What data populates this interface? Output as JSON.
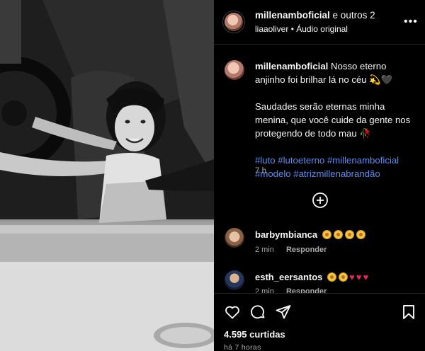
{
  "post": {
    "author": "millenamboficial",
    "coauthors_text": "e outros 2",
    "subtitle_user": "liaaoliver",
    "subtitle_sep": "•",
    "audio": "Áudio original",
    "more_icon": "more-horizontal-icon"
  },
  "caption": {
    "user": "millenamboficial",
    "line1": "Nosso eterno anjinho foi brilhar lá no céu 💫🖤",
    "line2": "Saudades serão eternas minha menina, que você cuide da gente nos protegendo de todo mau 🥀",
    "hashtags": [
      "#luto",
      "#lutoeterno",
      "#millenamboficial",
      "#modelo",
      "#atrizmillenabrandão"
    ],
    "time": "7 h"
  },
  "comments": [
    {
      "user": "barbymbianca",
      "text": "😳😳😳😳",
      "faces": 4,
      "hearts": 0,
      "time": "2 min",
      "reply": "Responder"
    },
    {
      "user": "esth_eersantos",
      "text": "😳😳💔💔💔",
      "faces": 2,
      "hearts": 3,
      "time": "2 min",
      "reply": "Responder"
    }
  ],
  "actions": {
    "likes": "4.595 curtidas",
    "ago": "há 7 horas",
    "icons": [
      "heart-icon",
      "comment-icon",
      "share-icon",
      "bookmark-icon"
    ]
  },
  "colors": {
    "background": "#000000",
    "hashtag": "#5b8cf0",
    "muted": "#a8a8a8",
    "divider": "#262626"
  }
}
